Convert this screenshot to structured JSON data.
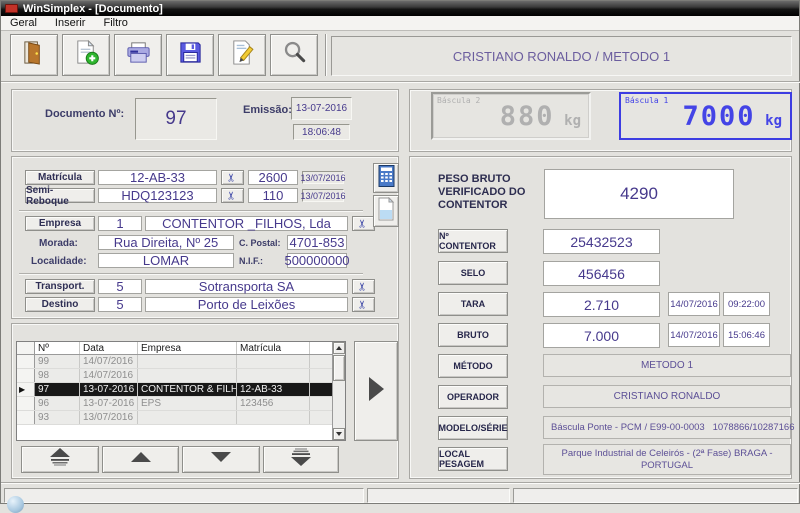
{
  "window": {
    "title": "WinSimplex - [Documento]"
  },
  "menu": {
    "items": [
      "Geral",
      "Inserir",
      "Filtro"
    ]
  },
  "header": {
    "title": "CRISTIANO RONALDO / METODO 1"
  },
  "icons": {
    "scissors": "✂",
    "row_marker": "▶"
  },
  "colors": {
    "accent_blue": "#3d3de2",
    "scale_gray": "#b0b0b0",
    "value_purple": "#46398c",
    "selected_row_bg": "#181818"
  },
  "toolbar": {
    "buttons": [
      {
        "name": "exit-door-icon"
      },
      {
        "name": "new-document-icon"
      },
      {
        "name": "print-icon"
      },
      {
        "name": "save-icon"
      },
      {
        "name": "edit-icon"
      },
      {
        "name": "search-icon"
      }
    ]
  },
  "doc": {
    "label": "Documento Nº:",
    "number": "97",
    "emissao_label": "Emissão:",
    "date": "13-07-2016",
    "time": "18:06:48"
  },
  "scales": {
    "b2_label": "Báscula 2",
    "b2_value": "880",
    "b2_unit": "kg",
    "b1_label": "Báscula 1",
    "b1_value": "7000",
    "b1_unit": "kg"
  },
  "form": {
    "matricula": {
      "label": "Matrícula",
      "value": "12-AB-33",
      "weight": "2600",
      "date": "13/07/2016"
    },
    "semi_reboque": {
      "label": "Semi-Reboque",
      "value": "HDQ123123",
      "weight": "110",
      "date": "13/07/2016"
    },
    "empresa": {
      "label": "Empresa",
      "code": "1",
      "name": "CONTENTOR _FILHOS, Lda"
    },
    "morada": {
      "label": "Morada:",
      "value": "Rua Direita, Nº 25"
    },
    "c_postal": {
      "label": "C. Postal:",
      "value": "4701-853"
    },
    "localidade": {
      "label": "Localidade:",
      "value": "LOMAR"
    },
    "nif": {
      "label": "N.I.F.:",
      "value": "500000000"
    },
    "transporte": {
      "label": "Transport.",
      "code": "5",
      "name": "Sotransporta SA"
    },
    "destino": {
      "label": "Destino",
      "code": "5",
      "name": "Porto de Leixões"
    }
  },
  "grid": {
    "headers": [
      "Nº",
      "Data",
      "Empresa",
      "Matrícula"
    ],
    "rows": [
      {
        "num": "99",
        "date": "14/07/2016",
        "empresa": "",
        "matricula": "",
        "selected": false
      },
      {
        "num": "98",
        "date": "14/07/2016",
        "empresa": "",
        "matricula": "",
        "selected": false
      },
      {
        "num": "97",
        "date": "13-07-2016",
        "empresa": "CONTENTOR & FILHO",
        "matricula": "12-AB-33",
        "selected": true
      },
      {
        "num": "96",
        "date": "13-07-2016",
        "empresa": "EPS",
        "matricula": "123456",
        "selected": false
      },
      {
        "num": "93",
        "date": "13/07/2016",
        "empresa": "",
        "matricula": "",
        "selected": false
      }
    ]
  },
  "weighing": {
    "peso_bruto_label": "PESO BRUTO VERIFICADO DO CONTENTOR",
    "peso_bruto_value": "4290",
    "contentor": {
      "label": "Nº CONTENTOR",
      "value": "25432523"
    },
    "selo": {
      "label": "SELO",
      "value": "456456"
    },
    "tara": {
      "label": "TARA",
      "value": "2.710",
      "date": "14/07/2016",
      "time": "09:22:00"
    },
    "bruto": {
      "label": "BRUTO",
      "value": "7.000",
      "date": "14/07/2016",
      "time": "15:06:46"
    },
    "metodo": {
      "label": "MÉTODO",
      "value": "METODO 1"
    },
    "operador": {
      "label": "OPERADOR",
      "value": "CRISTIANO RONALDO"
    },
    "modelo": {
      "label": "MODELO/SÉRIE",
      "value": "Báscula Ponte - PCM / E99-00-0003   1078866/10287166"
    },
    "local": {
      "label": "LOCAL PESAGEM",
      "value": "Parque Industrial de Celeirós - (2ª Fase) BRAGA - PORTUGAL"
    }
  }
}
